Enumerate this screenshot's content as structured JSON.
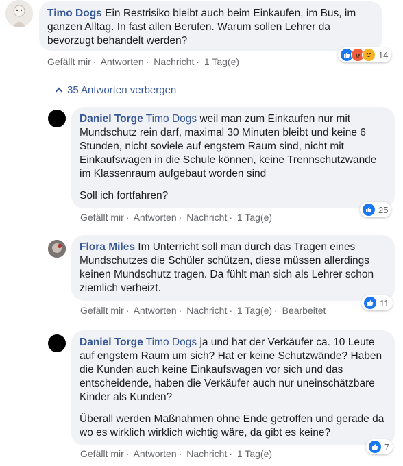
{
  "comments": [
    {
      "author": "Timo Dogs",
      "text": "Ein Restrisiko bleibt auch beim Einkaufen, im Bus, im ganzen Alltag. In fast allen Berufen. Warum sollen Lehrer da bevorzugt behandelt werden?",
      "actions": {
        "like": "Gefällt mir",
        "reply": "Antworten",
        "message": "Nachricht",
        "time": "1 Tag(e)"
      },
      "reactions": {
        "count": "14",
        "icons": [
          "like-icon",
          "angry-icon",
          "haha-icon"
        ],
        "colors": [
          "#1877f2",
          "#f33e58",
          "#f7b125"
        ]
      }
    }
  ],
  "replies_toggle": "35 Antworten verbergen",
  "replies": [
    {
      "author": "Daniel Torge",
      "mention": "Timo Dogs",
      "text": "weil man zum Einkaufen nur mit Mundschutz rein darf, maximal 30 Minuten bleibt und keine 6 Stunden, nicht soviele auf engstem Raum sind, nicht mit Einkaufswagen in die Schule können, keine Trennschutzwande im Klassenraum aufgebaut worden sind",
      "text2": "Soll ich fortfahren?",
      "actions": {
        "like": "Gefällt mir",
        "reply": "Antworten",
        "message": "Nachricht",
        "time": "1 Tag(e)"
      },
      "reactions": {
        "count": "25"
      }
    },
    {
      "author": "Flora Miles",
      "text": "Im Unterricht soll man durch das Tragen eines Mundschutzes die Schüler schützen, diese müssen allerdings keinen Mundschutz tragen. Da fühlt man sich als Lehrer schon ziemlich verheizt.",
      "actions": {
        "like": "Gefällt mir",
        "reply": "Antworten",
        "message": "Nachricht",
        "time": "1 Tag(e)",
        "edited": "Bearbeitet"
      },
      "reactions": {
        "count": "11"
      }
    },
    {
      "author": "Daniel Torge",
      "mention": "Timo Dogs",
      "text": "ja und hat der Verkäufer ca. 10 Leute auf engstem Raum um sich? Hat er keine Schutzwände? Haben die Kunden auch keine Einkaufswagen vor sich und das entscheidende, haben die Verkäufer auch nur uneinschätzbare Kinder als Kunden?",
      "text2": "Überall werden Maßnahmen ohne Ende getroffen und gerade da wo es wirklich wirklich wichtig wäre, da gibt es keine?",
      "actions": {
        "like": "Gefällt mir",
        "reply": "Antworten",
        "message": "Nachricht",
        "time": "1 Tag(e)"
      },
      "reactions": {
        "count": "7"
      }
    }
  ],
  "colors": {
    "link": "#385898",
    "like": "#1877f2",
    "bubble": "#f0f2f5",
    "meta": "#65676b"
  }
}
